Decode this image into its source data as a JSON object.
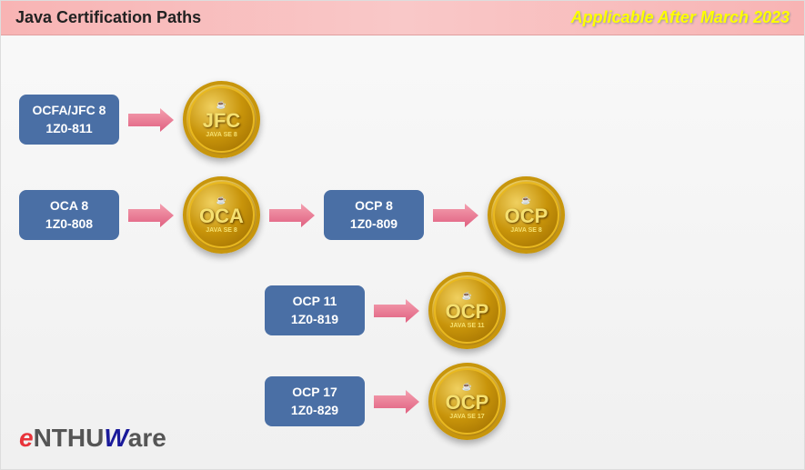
{
  "header": {
    "title": "Java Certification Paths",
    "subtitle": "Applicable After March 2023"
  },
  "rows": [
    {
      "id": "row1",
      "label_line1": "OCFA/JFC 8",
      "label_line2": "1Z0-811",
      "medal_text": "JFC",
      "medal_sub": "JAVA SE 8"
    },
    {
      "id": "row2",
      "label_line1": "OCA 8",
      "label_line2": "1Z0-808",
      "medal_text": "OCA",
      "medal_sub": "JAVA SE 8",
      "next_label_line1": "OCP 8",
      "next_label_line2": "1Z0-809",
      "next_medal_text": "OCP",
      "next_medal_sub": "JAVA SE 8"
    }
  ],
  "extra_rows": [
    {
      "id": "row3",
      "label_line1": "OCP 11",
      "label_line2": "1Z0-819",
      "medal_text": "OCP",
      "medal_sub": "JAVA SE 11"
    },
    {
      "id": "row4",
      "label_line1": "OCP 17",
      "label_line2": "1Z0-829",
      "medal_text": "OCP",
      "medal_sub": "JAVA SE 17"
    }
  ],
  "logo": {
    "e": "e",
    "nthu": "NTHU",
    "w": "W",
    "are": "are"
  }
}
